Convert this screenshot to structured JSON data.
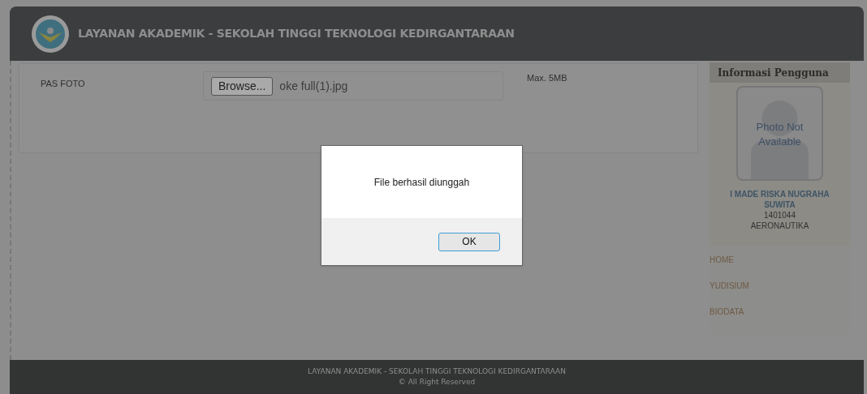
{
  "header": {
    "title": "LAYANAN AKADEMIK - SEKOLAH TINGGI TEKNOLOGI KEDIRGANTARAAN"
  },
  "form": {
    "label": "PAS FOTO",
    "browse_button": "Browse...",
    "file_name": "oke full(1).jpg",
    "hint": "Max. 5MB"
  },
  "sidebar": {
    "title": "Informasi Pengguna",
    "photo_text": "Photo Not Available",
    "name": "I MADE RISKA NUGRAHA SUWITA",
    "id": "1401044",
    "program": "AERONAUTIKA",
    "menu": [
      {
        "label": "HOME"
      },
      {
        "label": "YUDISIUM"
      },
      {
        "label": "BIODATA"
      }
    ]
  },
  "dialog": {
    "message": "File berhasil diunggah",
    "button": "OK"
  },
  "footer": {
    "line1": "LAYANAN AKADEMIK - SEKOLAH TINGGI TEKNOLOGI KEDIRGANTARAAN",
    "line2": "© All Right Reserved"
  }
}
